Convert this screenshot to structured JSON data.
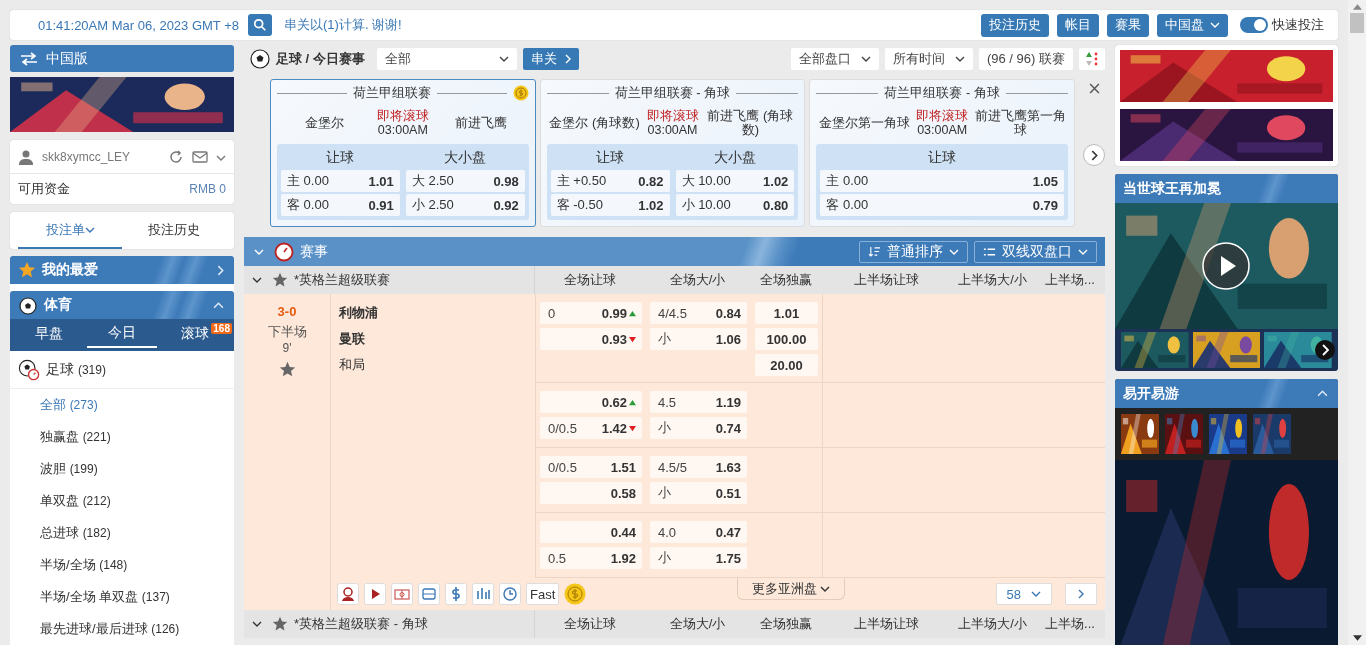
{
  "top_bar": {
    "datetime": "01:41:20AM Mar 06, 2023 GMT +8",
    "notice": "串关以(1)计算. 谢谢!",
    "buttons": [
      "投注历史",
      "帐目",
      "赛果"
    ],
    "odds_type": "中国盘",
    "quick_bet": {
      "label": "快速投注",
      "on": true
    }
  },
  "sidebar": {
    "version": "中国版",
    "user": {
      "name": "skk8xymcc_LEY",
      "funds_label": "可用资金",
      "funds": "RMB 0"
    },
    "bet_tabs": [
      {
        "label": "投注单",
        "selected": true
      },
      {
        "label": "投注历史",
        "selected": false
      }
    ],
    "favorites": "我的最爱",
    "sports": {
      "title": "体育",
      "expanded": true,
      "tabs": [
        {
          "label": "早盘",
          "selected": false
        },
        {
          "label": "今日",
          "selected": true
        },
        {
          "label": "滚球",
          "selected": false,
          "badge": "168"
        }
      ],
      "sport": {
        "name": "足球",
        "count": "(319)"
      },
      "items": [
        {
          "label": "全部",
          "count": "(273)",
          "selected": true
        },
        {
          "label": "独赢盘",
          "count": "(221)",
          "selected": false
        },
        {
          "label": "波胆",
          "count": "(199)",
          "selected": false
        },
        {
          "label": "单双盘",
          "count": "(212)",
          "selected": false
        },
        {
          "label": "总进球",
          "count": "(182)",
          "selected": false
        },
        {
          "label": "半场/全场",
          "count": "(148)",
          "selected": false
        },
        {
          "label": "半场/全场 单双盘",
          "count": "(137)",
          "selected": false
        },
        {
          "label": "最先进球/最后进球",
          "count": "(126)",
          "selected": false
        }
      ]
    }
  },
  "main": {
    "title": "足球 / 今日赛事",
    "filter": "全部",
    "parlay": "串关",
    "markets": "全部盘口",
    "time": "所有时间",
    "leagues": "(96 / 96) 联赛",
    "featured": [
      {
        "league": "荷兰甲组联赛",
        "home": "金堡尔",
        "away": "前进飞鹰",
        "status": "即将滚球",
        "time": "03:00AM",
        "selected": true,
        "cashout": true,
        "markets": [
          {
            "title": "让球",
            "lines": [
              {
                "label": "主 0.00",
                "odds": "1.01"
              },
              {
                "label": "客 0.00",
                "odds": "0.91"
              }
            ]
          },
          {
            "title": "大小盘",
            "lines": [
              {
                "label": "大 2.50",
                "odds": "0.98"
              },
              {
                "label": "小 2.50",
                "odds": "0.92"
              }
            ]
          }
        ]
      },
      {
        "league": "荷兰甲组联赛 - 角球",
        "home": "金堡尔 (角球数)",
        "away": "前进飞鹰 (角球数)",
        "status": "即将滚球",
        "time": "03:00AM",
        "selected": false,
        "cashout": false,
        "markets": [
          {
            "title": "让球",
            "lines": [
              {
                "label": "主 +0.50",
                "odds": "0.82"
              },
              {
                "label": "客 -0.50",
                "odds": "1.02"
              }
            ]
          },
          {
            "title": "大小盘",
            "lines": [
              {
                "label": "大 10.00",
                "odds": "1.02"
              },
              {
                "label": "小 10.00",
                "odds": "0.80"
              }
            ]
          }
        ]
      },
      {
        "league": "荷兰甲组联赛 - 角球",
        "home": "金堡尔第一角球",
        "away": "前进飞鹰第一角球",
        "status": "即将滚球",
        "time": "03:00AM",
        "selected": false,
        "cashout": false,
        "markets": [
          {
            "title": "让球",
            "lines": [
              {
                "label": "主 0.00",
                "odds": "1.05"
              },
              {
                "label": "客 0.00",
                "odds": "0.79"
              }
            ]
          }
        ]
      }
    ],
    "events": {
      "title": "赛事",
      "sort": "普通排序",
      "view": "双线双盘口",
      "leagues": [
        {
          "name": "*英格兰超级联赛",
          "columns": [
            "全场让球",
            "全场大/小",
            "全场独赢",
            "上半场让球",
            "上半场大/小",
            "上半场..."
          ],
          "match": {
            "score": "3-0",
            "period": "下半场",
            "minute": "9'",
            "teams": [
              {
                "name": "利物浦",
                "bold": true
              },
              {
                "name": "曼联",
                "bold": true
              },
              {
                "name": "和局",
                "bold": false
              }
            ],
            "groups": [
              {
                "hdp": [
                  {
                    "line": "0",
                    "odds": "0.99",
                    "up": true
                  },
                  {
                    "odds": "0.93",
                    "up": false
                  }
                ],
                "ou": [
                  {
                    "line": "4/4.5",
                    "odds": "0.84"
                  },
                  {
                    "line": "小",
                    "odds": "1.06"
                  }
                ],
                "x12": [
                  "1.01",
                  "100.00",
                  "20.00"
                ]
              },
              {
                "hdp": [
                  {
                    "odds": "0.62",
                    "up": true
                  },
                  {
                    "line": "0/0.5",
                    "odds": "1.42",
                    "up": false
                  }
                ],
                "ou": [
                  {
                    "line": "4.5",
                    "odds": "1.19"
                  },
                  {
                    "line": "小",
                    "odds": "0.74"
                  }
                ]
              },
              {
                "hdp": [
                  {
                    "line": "0/0.5",
                    "odds": "1.51"
                  },
                  {
                    "odds": "0.58"
                  }
                ],
                "ou": [
                  {
                    "line": "4.5/5",
                    "odds": "1.63"
                  },
                  {
                    "line": "小",
                    "odds": "0.51"
                  }
                ]
              },
              {
                "hdp": [
                  {
                    "odds": "0.44"
                  },
                  {
                    "line": "0.5",
                    "odds": "1.92"
                  }
                ],
                "ou": [
                  {
                    "line": "4.0",
                    "odds": "0.47"
                  },
                  {
                    "line": "小",
                    "odds": "1.75"
                  }
                ]
              }
            ],
            "fast": "Fast",
            "more": "更多亚洲盘",
            "page": "58"
          }
        },
        {
          "name": "*英格兰超级联赛 - 角球",
          "columns": [
            "全场让球",
            "全场大/小",
            "全场独赢",
            "上半场让球",
            "上半场大/小",
            "上半场..."
          ]
        }
      ]
    }
  },
  "right": {
    "video_title": "当世球王再加冕",
    "games_title": "易开易游"
  }
}
